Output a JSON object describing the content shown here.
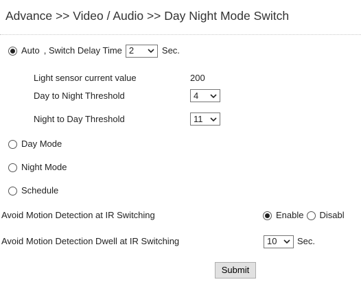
{
  "header": {
    "title": "Advance >> Video / Audio >> Day Night Mode Switch"
  },
  "auto_mode": {
    "label": "Auto",
    "switch_delay_label": ", Switch Delay Time",
    "switch_delay_value": "2",
    "switch_delay_unit": "Sec.",
    "selected": true
  },
  "light_sensor": {
    "label": "Light sensor current value",
    "value": "200"
  },
  "day_to_night": {
    "label": "Day to Night Threshold",
    "value": "4"
  },
  "night_to_day": {
    "label": "Night to Day Threshold",
    "value": "11"
  },
  "modes": {
    "day": "Day Mode",
    "night": "Night Mode",
    "schedule": "Schedule"
  },
  "avoid_motion_ir": {
    "label": "Avoid Motion Detection at IR Switching",
    "enable_label": "Enable",
    "disable_label": "Disabl",
    "selected": "Enable"
  },
  "avoid_motion_dwell": {
    "label": "Avoid Motion Detection Dwell at IR Switching",
    "value": "10",
    "unit": "Sec."
  },
  "submit_label": "Submit"
}
